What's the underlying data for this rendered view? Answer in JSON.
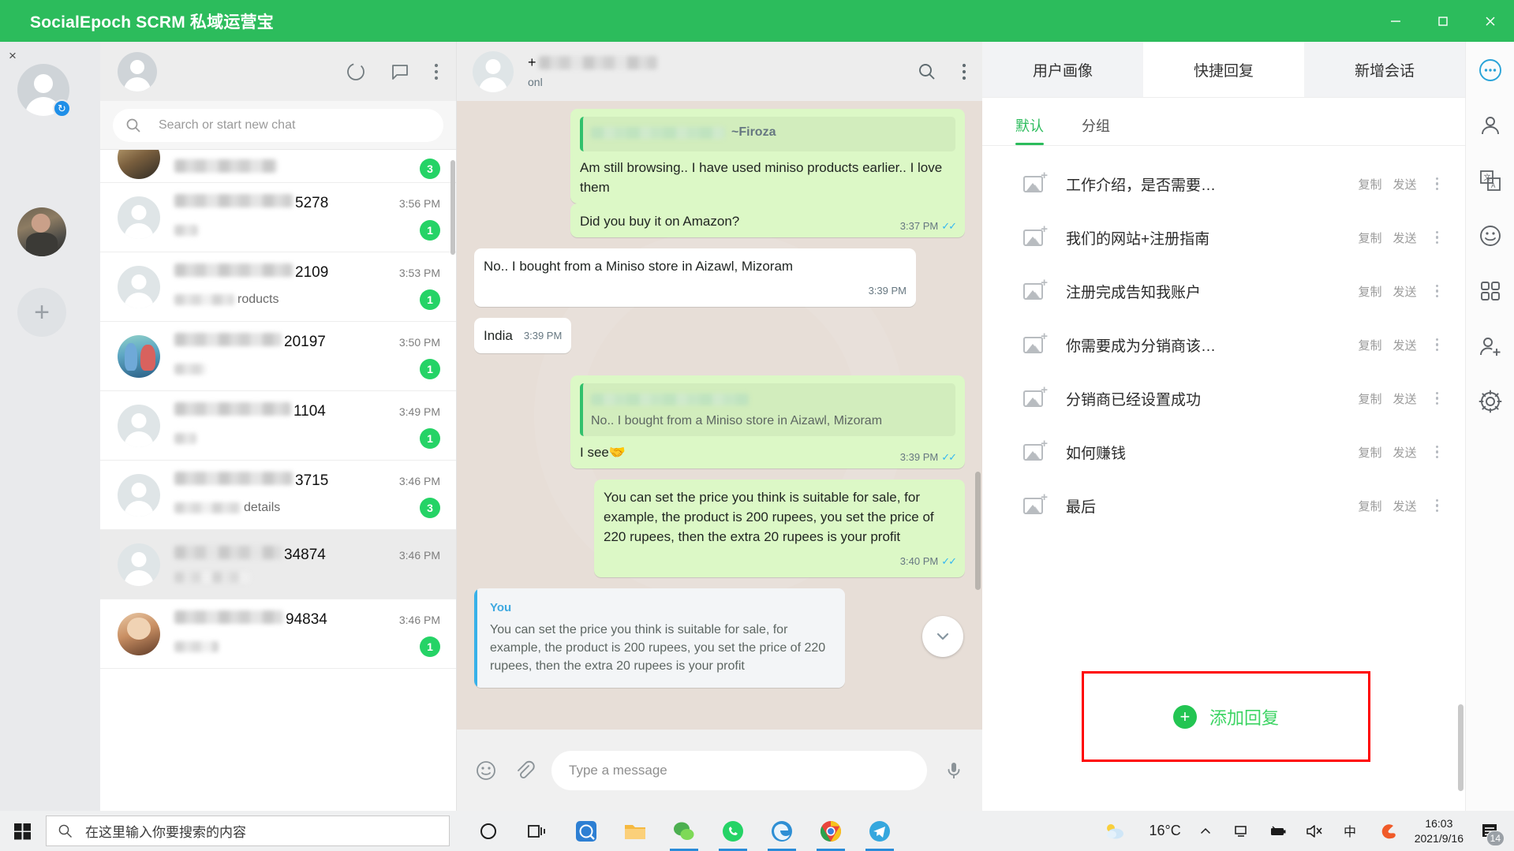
{
  "window": {
    "title": "SocialEpoch SCRM 私域运营宝",
    "minimize_icon": "minimize-icon",
    "maximize_icon": "maximize-icon",
    "close_icon": "close-icon",
    "accent_color": "#2cbc5c"
  },
  "left_rail": {
    "close_label": "×",
    "account_badge": "↻",
    "add_label": "+"
  },
  "chat_list": {
    "search_placeholder": "Search or start new chat",
    "search_icon": "search-icon",
    "status_icon": "status-ring-icon",
    "new_chat_icon": "new-chat-icon",
    "menu_icon": "kebab-menu-icon",
    "items": [
      {
        "name_suffix": "",
        "time": "",
        "message": "",
        "badge": "3",
        "avatar": "photo-top",
        "partial": true
      },
      {
        "name_suffix": "5278",
        "time": "3:56 PM",
        "message": "",
        "badge": "1",
        "avatar": "default",
        "partial": false
      },
      {
        "name_suffix": "2109",
        "time": "3:53 PM",
        "message": "roducts",
        "badge": "1",
        "avatar": "default",
        "partial": false
      },
      {
        "name_suffix": "20197",
        "time": "3:50 PM",
        "message": "",
        "badge": "1",
        "avatar": "photo-shiva",
        "partial": false
      },
      {
        "name_suffix": "1104",
        "time": "3:49 PM",
        "message": "",
        "badge": "1",
        "avatar": "default",
        "partial": false
      },
      {
        "name_suffix": "3715",
        "time": "3:46 PM",
        "message": "details",
        "badge": "3",
        "avatar": "default",
        "partial": false
      },
      {
        "name_suffix": "34874",
        "time": "3:46 PM",
        "message": "",
        "badge": "",
        "avatar": "default",
        "partial": false
      },
      {
        "name_suffix": "94834",
        "time": "3:46 PM",
        "message": "",
        "badge": "1",
        "avatar": "photo-girl",
        "partial": false
      }
    ]
  },
  "conversation": {
    "contact_prefix": "+",
    "contact_status": "onl",
    "search_icon": "search-icon",
    "menu_icon": "kebab-menu-icon",
    "scroll_down_icon": "chevron-down-icon",
    "messages": [
      {
        "side": "out",
        "quote": {
          "author_blurred": true,
          "suffix": "~Firoza",
          "text": ""
        },
        "text": "Am still browsing.. I have used miniso products earlier.. I love them",
        "time": "",
        "ticks": false
      },
      {
        "side": "out",
        "text": "Did you buy it on Amazon?",
        "time": "3:37 PM",
        "ticks": true
      },
      {
        "side": "in",
        "text": "No.. I bought from a Miniso store in Aizawl, Mizoram",
        "time": "3:39 PM",
        "ticks": false
      },
      {
        "side": "in",
        "text": "India",
        "time": "3:39 PM",
        "ticks": false
      },
      {
        "side": "out",
        "quote": {
          "author_blurred": true,
          "suffix": "",
          "text": "No.. I bought from a Miniso store in Aizawl, Mizoram"
        },
        "text": "I see🤝",
        "time": "3:39 PM",
        "ticks": true
      },
      {
        "side": "out",
        "text": "You can set the price you think is suitable for sale, for example, the product is 200 rupees, you set the price of 220 rupees, then the extra 20 rupees is your profit",
        "time": "3:40 PM",
        "ticks": true
      }
    ],
    "preview_quote": {
      "author": "You",
      "text": "You can set the price you think is suitable for sale, for example, the product is 200 rupees, you set the price of 220 rupees, then the extra 20 rupees is your profit"
    },
    "composer": {
      "emoji_icon": "emoji-icon",
      "attach_icon": "paperclip-icon",
      "placeholder": "Type a message",
      "mic_icon": "microphone-icon"
    }
  },
  "scrm_panel": {
    "tabs": [
      {
        "label": "用户画像",
        "active": false
      },
      {
        "label": "快捷回复",
        "active": true
      },
      {
        "label": "新增会话",
        "active": false
      }
    ],
    "more_icon": "more-circle-icon",
    "subtabs": [
      {
        "label": "默认",
        "active": true
      },
      {
        "label": "分组",
        "active": false
      }
    ],
    "copy_label": "复制",
    "send_label": "发送",
    "item_icon": "image-add-icon",
    "kebab_icon": "kebab-menu-icon",
    "replies": [
      {
        "label": "工作介绍，是否需要…"
      },
      {
        "label": "我们的网站+注册指南"
      },
      {
        "label": "注册完成告知我账户"
      },
      {
        "label": "你需要成为分销商该…"
      },
      {
        "label": "分销商已经设置成功"
      },
      {
        "label": "如何赚钱"
      },
      {
        "label": "最后"
      }
    ],
    "add_reply": {
      "label": "添加回复",
      "plus": "+",
      "highlight_color": "#ff0000"
    }
  },
  "right_rail": {
    "icons": [
      "chat-bubble-icon",
      "contact-icon",
      "translate-icon",
      "sticker-icon",
      "apps-grid-icon",
      "add-user-icon",
      "settings-gear-icon"
    ]
  },
  "taskbar": {
    "start_icon": "windows-start-icon",
    "search_icon": "search-icon",
    "search_placeholder": "在这里输入你要搜索的内容",
    "cortana_icon": "cortana-circle-icon",
    "task_view_icon": "task-view-icon",
    "apps": [
      "browser-blue-icon",
      "file-explorer-icon",
      "wechat-icon",
      "whatsapp-icon",
      "edge-icon",
      "chrome-icon",
      "telegram-icon"
    ],
    "tray": {
      "weather_icon": "partly-cloudy-icon",
      "temperature": "16°C",
      "chevron_icon": "chevron-up-icon",
      "network_icon": "network-icon",
      "battery_icon": "battery-icon",
      "volume_icon": "volume-muted-icon",
      "ime_icon": "ime-chinese-icon",
      "ime_label": "中",
      "sogou_icon": "sogou-icon",
      "time": "16:03",
      "date": "2021/9/16",
      "notification_icon": "notification-icon",
      "notification_count": "14"
    }
  }
}
